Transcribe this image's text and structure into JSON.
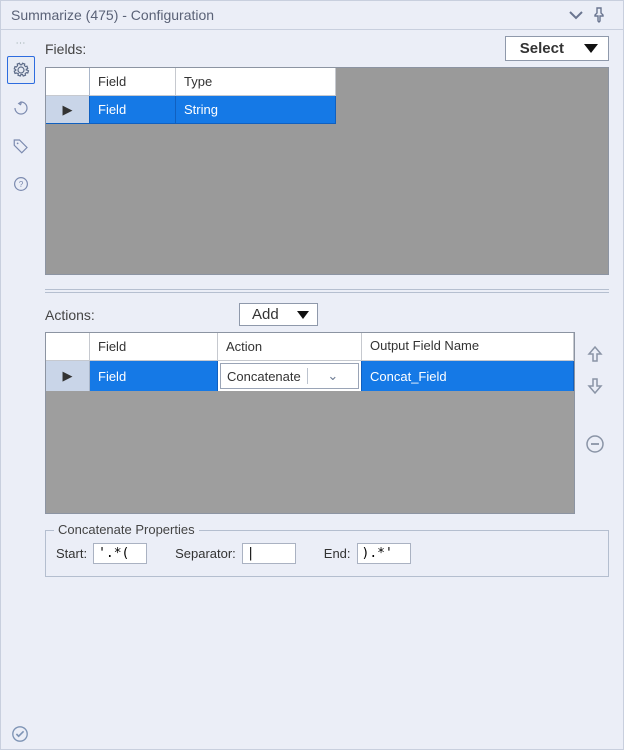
{
  "title": "Summarize (475) - Configuration",
  "fields": {
    "label": "Fields:",
    "select_btn": "Select",
    "columns": {
      "field": "Field",
      "type": "Type"
    },
    "row": {
      "field": "Field",
      "type": "String"
    }
  },
  "actions": {
    "label": "Actions:",
    "add_btn": "Add",
    "columns": {
      "field": "Field",
      "action": "Action",
      "output": "Output Field Name"
    },
    "row": {
      "field": "Field",
      "action": "Concatenate",
      "output": "Concat_Field"
    }
  },
  "concat": {
    "legend": "Concatenate Properties",
    "start_label": "Start:",
    "start_value": "'.*(",
    "sep_label": "Separator:",
    "sep_value": "|",
    "end_label": "End:",
    "end_value": ").*'"
  }
}
